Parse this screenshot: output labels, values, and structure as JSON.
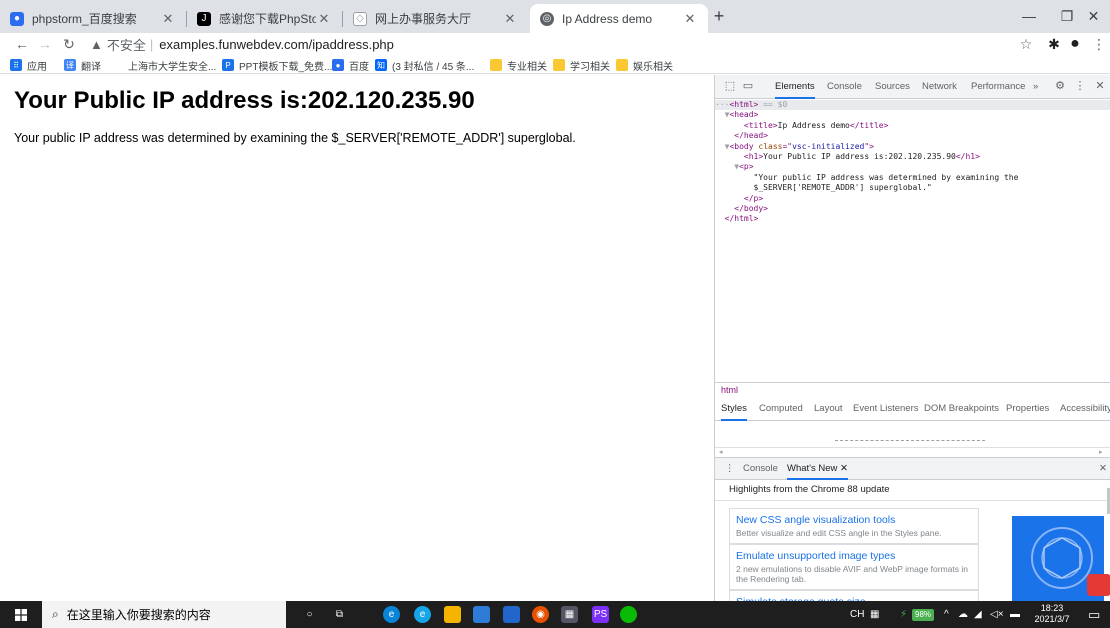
{
  "colors": {
    "tabstrip_bg": "#dee1e6",
    "accent": "#1a73e8",
    "taskbar_bg": "#1e1e1e",
    "devtools_tag": "#881280",
    "devtools_attr_value": "#1a1aa6"
  },
  "tabs": [
    {
      "title": "phpstorm_百度搜索",
      "icon": "baidu-paw-icon",
      "active": false
    },
    {
      "title": "感谢您下载PhpStorm!",
      "icon": "jetbrains-icon",
      "active": false
    },
    {
      "title": "网上办事服务大厅",
      "icon": "gov-site-icon",
      "active": false
    },
    {
      "title": "Ip Address demo",
      "icon": "globe-icon",
      "active": true
    }
  ],
  "toolbar": {
    "insecure_label": "不安全",
    "url": "examples.funwebdev.com/ipaddress.php"
  },
  "bookmarks": [
    {
      "label": "应用",
      "icon": "apps-grid-icon"
    },
    {
      "label": "翻译",
      "icon": "translate-icon"
    },
    {
      "label": "上海市大学生安全...",
      "icon": ""
    },
    {
      "label": "PPT模板下载_免费...",
      "icon": "ppt-icon"
    },
    {
      "label": "百度",
      "icon": "baidu-paw-icon"
    },
    {
      "label": "(3 封私信 / 45 条...",
      "icon": "zhihu-icon"
    },
    {
      "label": "专业相关",
      "icon": "folder-icon"
    },
    {
      "label": "学习相关",
      "icon": "folder-icon"
    },
    {
      "label": "娱乐相关",
      "icon": "folder-icon"
    }
  ],
  "page": {
    "heading": "Your Public IP address is:202.120.235.90",
    "paragraph": "Your public IP address was determined by examining the $_SERVER['REMOTE_ADDR'] superglobal."
  },
  "devtools": {
    "tabs": [
      "Elements",
      "Console",
      "Sources",
      "Network",
      "Performance"
    ],
    "more": "»",
    "dom": {
      "html_line_suffix": " == $0",
      "title_text": "Ip Address demo",
      "body_class": "vsc-initialized",
      "h1_text": "Your Public IP address is:202.120.235.90",
      "p_text_1": "\"Your public IP address was determined by examining the",
      "p_text_2": "$_SERVER['REMOTE_ADDR'] superglobal.\""
    },
    "breadcrumb": "html",
    "subtabs": [
      "Styles",
      "Computed",
      "Layout",
      "Event Listeners",
      "DOM Breakpoints",
      "Properties",
      "Accessibility"
    ],
    "drawer": {
      "tabs": [
        "Console",
        "What's New"
      ],
      "highlights": "Highlights from the Chrome 88 update",
      "cards": [
        {
          "title": "New CSS angle visualization tools",
          "desc": "Better visualize and edit CSS angle in the Styles pane."
        },
        {
          "title": "Emulate unsupported image types",
          "desc": "2 new emulations to disable AVIF and WebP image formats in the Rendering tab."
        },
        {
          "title": "Simulate storage quota size",
          "desc": ""
        }
      ]
    }
  },
  "taskbar": {
    "search_placeholder": "在这里输入你要搜索的内容",
    "ime": "CH",
    "battery": "98%",
    "time": "18:23",
    "date": "2021/3/7"
  }
}
